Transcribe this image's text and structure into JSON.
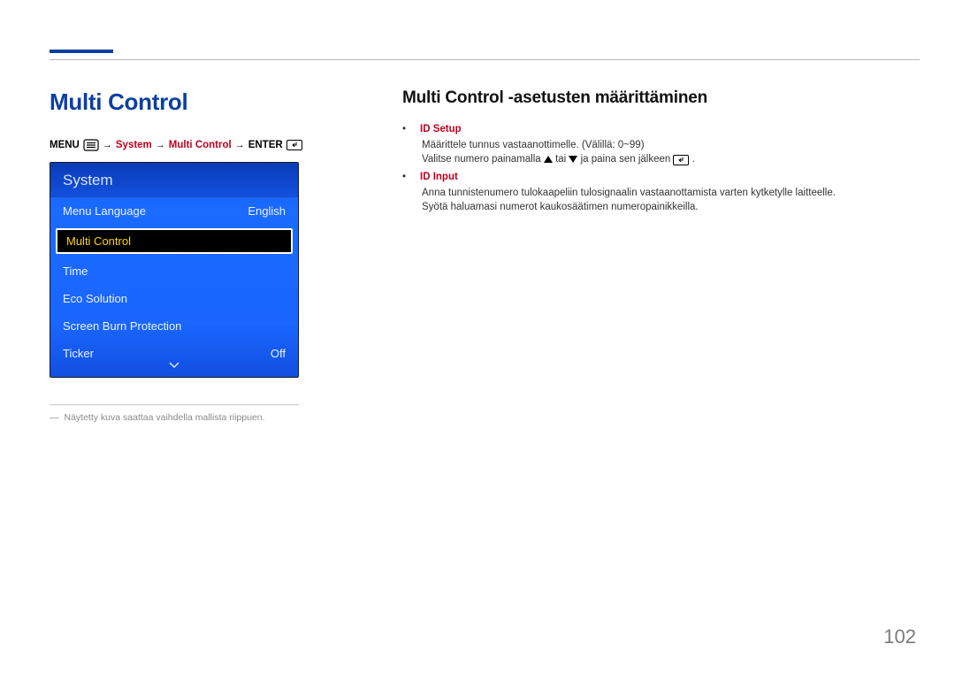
{
  "title_left": "Multi Control",
  "breadcrumb": {
    "menu_label": "MENU",
    "system_label": "System",
    "multi_label": "Multi Control",
    "enter_label": "ENTER"
  },
  "panel": {
    "title": "System",
    "rows": [
      {
        "label": "Menu Language",
        "value": "English"
      },
      {
        "label": "Multi Control",
        "value": ""
      },
      {
        "label": "Time",
        "value": ""
      },
      {
        "label": "Eco Solution",
        "value": ""
      },
      {
        "label": "Screen Burn Protection",
        "value": ""
      },
      {
        "label": "Ticker",
        "value": "Off"
      }
    ],
    "selected_index": 1
  },
  "footnote": "Näytetty kuva saattaa vaihdella mallista riippuen.",
  "right": {
    "subtitle": "Multi Control -asetusten määrittäminen",
    "items": [
      {
        "label": "ID Setup",
        "lines": [
          "Määrittele tunnus vastaanottimelle. (Välillä: 0~99)",
          "Valitse numero painamalla ▲ tai ▼ ja paina sen jälkeen ⏎."
        ]
      },
      {
        "label": "ID Input",
        "lines": [
          "Anna tunnistenumero tulokaapeliin tulosignaalin vastaanottamista varten kytketylle laitteelle.",
          "Syötä haluamasi numerot kaukosäätimen numeropainikkeilla."
        ]
      }
    ]
  },
  "page_number": "102"
}
